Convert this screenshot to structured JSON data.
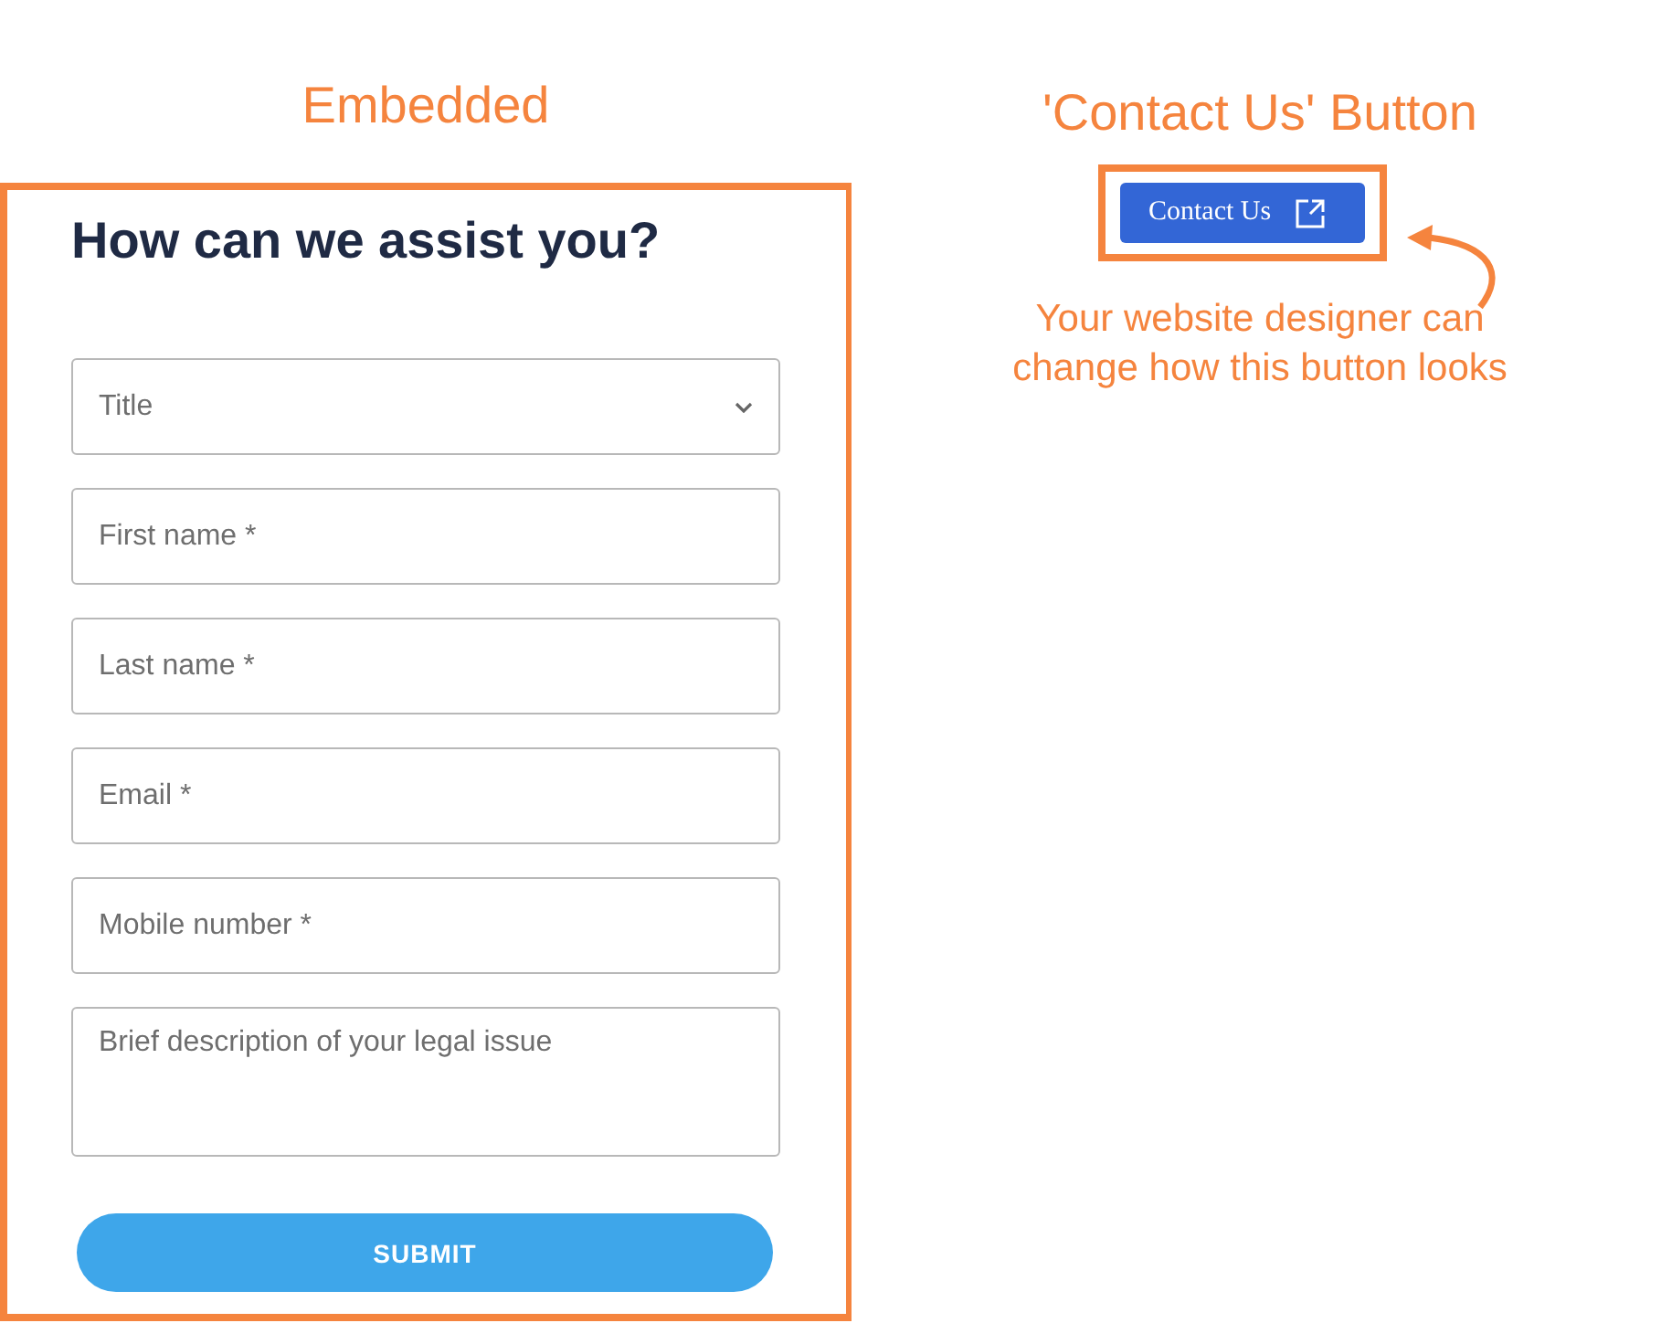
{
  "embedded": {
    "label": "Embedded",
    "form": {
      "heading": "How can we assist you?",
      "fields": [
        {
          "kind": "select",
          "placeholder": "Title"
        },
        {
          "kind": "input",
          "placeholder": "First name *"
        },
        {
          "kind": "input",
          "placeholder": "Last name *"
        },
        {
          "kind": "input",
          "placeholder": "Email *"
        },
        {
          "kind": "input",
          "placeholder": "Mobile number *"
        },
        {
          "kind": "textarea",
          "placeholder": "Brief description of your legal issue"
        }
      ],
      "submit": "SUBMIT"
    }
  },
  "button_demo": {
    "label": "'Contact Us' Button",
    "button": "Contact Us",
    "caption": "Your website designer can change how this button looks"
  }
}
